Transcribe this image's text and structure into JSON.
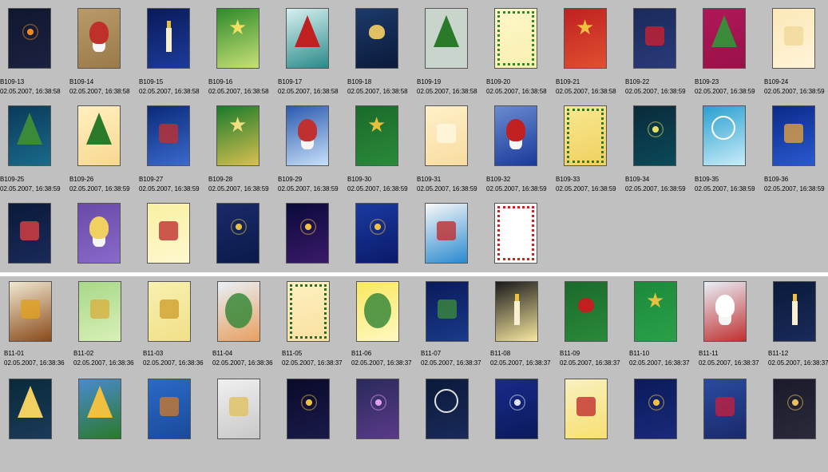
{
  "panels": [
    {
      "rows": [
        [
          {
            "id": "B109-13",
            "date": "02.05.2007, 16:38:58",
            "thumb": "fireplace",
            "colors": [
              "#0f1730",
              "#1b2240",
              "#f08a20"
            ]
          },
          {
            "id": "B109-14",
            "date": "02.05.2007, 16:38:58",
            "thumb": "elf-on-branch",
            "colors": [
              "#b89a6a",
              "#9a7a48",
              "#c0302a"
            ]
          },
          {
            "id": "B109-15",
            "date": "02.05.2007, 16:38:58",
            "thumb": "lantern",
            "colors": [
              "#0a1a5a",
              "#1c3c9a",
              "#e8c040"
            ]
          },
          {
            "id": "B109-16",
            "date": "02.05.2007, 16:38:58",
            "thumb": "green-oval-stars",
            "colors": [
              "#2e8a2a",
              "#c8e078",
              "#f0e060"
            ]
          },
          {
            "id": "B109-17",
            "date": "02.05.2007, 16:38:58",
            "thumb": "holly-teal",
            "colors": [
              "#d8f0f0",
              "#2a8a8a",
              "#c02020"
            ]
          },
          {
            "id": "B109-18",
            "date": "02.05.2007, 16:38:58",
            "thumb": "heart-ornament",
            "colors": [
              "#1c3a6a",
              "#0a1a3a",
              "#e0c060"
            ]
          },
          {
            "id": "B109-19",
            "date": "02.05.2007, 16:38:58",
            "thumb": "holly-corner",
            "colors": [
              "#c8d4cc",
              "#c8d4cc",
              "#2a7a2a"
            ]
          },
          {
            "id": "B109-20",
            "date": "02.05.2007, 16:38:58",
            "thumb": "holly-frame",
            "colors": [
              "#fff6c8",
              "#f8f0b0",
              "#2a8a2a"
            ]
          },
          {
            "id": "B109-21",
            "date": "02.05.2007, 16:38:58",
            "thumb": "star-red",
            "colors": [
              "#c02020",
              "#e05030",
              "#f0c040"
            ]
          },
          {
            "id": "B109-22",
            "date": "02.05.2007, 16:38:59",
            "thumb": "poinsettia",
            "colors": [
              "#1a2a5a",
              "#2a3a7a",
              "#c82030"
            ]
          },
          {
            "id": "B109-23",
            "date": "02.05.2007, 16:38:59",
            "thumb": "holly-magenta",
            "colors": [
              "#b01858",
              "#9a1048",
              "#3a8a3a"
            ]
          },
          {
            "id": "B109-24",
            "date": "02.05.2007, 16:38:59",
            "thumb": "cream-plain",
            "colors": [
              "#fbe8b8",
              "#fff4d8",
              "#f0d898"
            ]
          }
        ],
        [
          {
            "id": "B109-25",
            "date": "02.05.2007, 16:38:59",
            "thumb": "teal-garland",
            "colors": [
              "#0a3a5a",
              "#1a6a8a",
              "#3a8a3a"
            ]
          },
          {
            "id": "B109-26",
            "date": "02.05.2007, 16:38:59",
            "thumb": "pine-branch",
            "colors": [
              "#fff0c0",
              "#f8d890",
              "#2a7a2a"
            ]
          },
          {
            "id": "B109-27",
            "date": "02.05.2007, 16:38:59",
            "thumb": "gift-blue",
            "colors": [
              "#0a2a7a",
              "#3a6acc",
              "#c03030"
            ]
          },
          {
            "id": "B109-28",
            "date": "02.05.2007, 16:38:59",
            "thumb": "green-gold",
            "colors": [
              "#1a7a2a",
              "#d8c050",
              "#f0e080"
            ]
          },
          {
            "id": "B109-29",
            "date": "02.05.2007, 16:38:59",
            "thumb": "gnome-snow",
            "colors": [
              "#2a5ab0",
              "#c8e0f8",
              "#c03030"
            ]
          },
          {
            "id": "B109-30",
            "date": "02.05.2007, 16:38:59",
            "thumb": "gold-stars-green",
            "colors": [
              "#1a6a2a",
              "#2a8a3a",
              "#e8c040"
            ]
          },
          {
            "id": "B109-31",
            "date": "02.05.2007, 16:38:59",
            "thumb": "cream-rays",
            "colors": [
              "#fff0c8",
              "#f8dca0",
              "#fff8e0"
            ]
          },
          {
            "id": "B109-32",
            "date": "02.05.2007, 16:38:59",
            "thumb": "santa-blue",
            "colors": [
              "#6a8ad0",
              "#1a3a9a",
              "#c02020"
            ]
          },
          {
            "id": "B109-33",
            "date": "02.05.2007, 16:38:59",
            "thumb": "wreath-arch",
            "colors": [
              "#f8e890",
              "#f0d060",
              "#2a7a2a"
            ]
          },
          {
            "id": "B109-34",
            "date": "02.05.2007, 16:38:59",
            "thumb": "fireworks-teal",
            "colors": [
              "#0a2a3a",
              "#0a4a5a",
              "#e8e060"
            ]
          },
          {
            "id": "B109-35",
            "date": "02.05.2007, 16:38:59",
            "thumb": "clock-cyan",
            "colors": [
              "#2aa0d0",
              "#c8ecf8",
              "#ffffff"
            ]
          },
          {
            "id": "B109-36",
            "date": "02.05.2007, 16:38:59",
            "thumb": "building-night",
            "colors": [
              "#0a2a8a",
              "#2a5ad0",
              "#e0a040"
            ]
          }
        ],
        [
          {
            "id": "",
            "date": "",
            "thumb": "village-night",
            "colors": [
              "#0a1a3a",
              "#1a2a5a",
              "#e04040"
            ]
          },
          {
            "id": "",
            "date": "",
            "thumb": "wizard-purple",
            "colors": [
              "#6a4aa8",
              "#8a6ac8",
              "#f0d060"
            ]
          },
          {
            "id": "",
            "date": "",
            "thumb": "kite-yellow",
            "colors": [
              "#f8f0a0",
              "#fff8d0",
              "#c03030"
            ]
          },
          {
            "id": "",
            "date": "",
            "thumb": "rockets-blue",
            "colors": [
              "#1a2a6a",
              "#0a1a4a",
              "#e8c040"
            ]
          },
          {
            "id": "",
            "date": "",
            "thumb": "rockets-night",
            "colors": [
              "#0a0a3a",
              "#3a1a6a",
              "#f0c040"
            ]
          },
          {
            "id": "",
            "date": "",
            "thumb": "rocket-trail",
            "colors": [
              "#1a3aa0",
              "#0a1a6a",
              "#f0c040"
            ]
          },
          {
            "id": "",
            "date": "",
            "thumb": "cake-sky",
            "colors": [
              "#f8f8f8",
              "#2a8ad0",
              "#c03030"
            ]
          },
          {
            "id": "",
            "date": "",
            "thumb": "boom-frame",
            "colors": [
              "#ffffff",
              "#ffffff",
              "#d02020"
            ]
          }
        ]
      ]
    },
    {
      "rows": [
        [
          {
            "id": "B11-01",
            "date": "02.05.2007, 16:38:36",
            "thumb": "barrel-party",
            "colors": [
              "#f0e8d0",
              "#8a4a1a",
              "#e0a020"
            ]
          },
          {
            "id": "B11-02",
            "date": "02.05.2007, 16:38:36",
            "thumb": "easter-green",
            "colors": [
              "#a8d888",
              "#d8f0b8",
              "#d8b040"
            ]
          },
          {
            "id": "B11-03",
            "date": "02.05.2007, 16:38:36",
            "thumb": "pattern-yellow",
            "colors": [
              "#f8f0b0",
              "#f0e088",
              "#d0a030"
            ]
          },
          {
            "id": "B11-04",
            "date": "02.05.2007, 16:38:36",
            "thumb": "painted-egg",
            "colors": [
              "#e8f0f8",
              "#e8a060",
              "#3a8a3a"
            ]
          },
          {
            "id": "B11-05",
            "date": "02.05.2007, 16:38:37",
            "thumb": "pine-frame",
            "colors": [
              "#fff0c0",
              "#f8e0a0",
              "#2a6a2a"
            ]
          },
          {
            "id": "B11-06",
            "date": "02.05.2007, 16:38:37",
            "thumb": "sun-burst",
            "colors": [
              "#f8e860",
              "#fff8c0",
              "#3a8a3a"
            ]
          },
          {
            "id": "B11-07",
            "date": "02.05.2007, 16:38:37",
            "thumb": "ornament-night",
            "colors": [
              "#0a1a5a",
              "#1a3a8a",
              "#3a8a3a"
            ]
          },
          {
            "id": "B11-08",
            "date": "02.05.2007, 16:38:37",
            "thumb": "candle-dark",
            "colors": [
              "#1a1a1a",
              "#f8e8a0",
              "#f0c040"
            ]
          },
          {
            "id": "B11-09",
            "date": "02.05.2007, 16:38:37",
            "thumb": "hearts-green",
            "colors": [
              "#1a6a2a",
              "#2a8a3a",
              "#c02020"
            ]
          },
          {
            "id": "B11-10",
            "date": "02.05.2007, 16:38:37",
            "thumb": "stars-green",
            "colors": [
              "#1a8a3a",
              "#2aa04a",
              "#e8c040"
            ]
          },
          {
            "id": "B11-11",
            "date": "02.05.2007, 16:38:37",
            "thumb": "santa-face",
            "colors": [
              "#e8f0f8",
              "#c03030",
              "#ffffff"
            ]
          },
          {
            "id": "B11-12",
            "date": "02.05.2007, 16:38:37",
            "thumb": "candle-night",
            "colors": [
              "#0a1a3a",
              "#1a2a5a",
              "#f0c040"
            ]
          }
        ],
        [
          {
            "id": "",
            "date": "",
            "thumb": "garland-night",
            "colors": [
              "#0a2a3a",
              "#1a3a5a",
              "#f0d060"
            ]
          },
          {
            "id": "",
            "date": "",
            "thumb": "xmas-tree",
            "colors": [
              "#4a8ad0",
              "#2a7a2a",
              "#f0c040"
            ]
          },
          {
            "id": "",
            "date": "",
            "thumb": "roast-turkey",
            "colors": [
              "#2a6ac8",
              "#1a4a9a",
              "#c87830"
            ]
          },
          {
            "id": "",
            "date": "",
            "thumb": "church-window",
            "colors": [
              "#f0f0f0",
              "#c8c8c8",
              "#e0c060"
            ]
          },
          {
            "id": "",
            "date": "",
            "thumb": "fireworks-night",
            "colors": [
              "#0a0a2a",
              "#1a1a4a",
              "#f0c040"
            ]
          },
          {
            "id": "",
            "date": "",
            "thumb": "fireworks-purple",
            "colors": [
              "#2a2a5a",
              "#5a3a8a",
              "#e0a0f0"
            ]
          },
          {
            "id": "",
            "date": "",
            "thumb": "clock-night",
            "colors": [
              "#0a1a3a",
              "#1a2a5a",
              "#e0e0e0"
            ]
          },
          {
            "id": "",
            "date": "",
            "thumb": "starfield",
            "colors": [
              "#1a2a8a",
              "#0a1a5a",
              "#e0e8ff"
            ]
          },
          {
            "id": "",
            "date": "",
            "thumb": "champagne",
            "colors": [
              "#f8f0c0",
              "#f8e070",
              "#c03030"
            ]
          },
          {
            "id": "",
            "date": "",
            "thumb": "fireworks-blue",
            "colors": [
              "#0a1a5a",
              "#1a2a7a",
              "#f0c040"
            ]
          },
          {
            "id": "",
            "date": "",
            "thumb": "cracker-red",
            "colors": [
              "#2a4aa0",
              "#1a2a6a",
              "#c02040"
            ]
          },
          {
            "id": "",
            "date": "",
            "thumb": "sparkler-gold",
            "colors": [
              "#1a1a2a",
              "#2a2a3a",
              "#e8c060"
            ]
          }
        ]
      ]
    }
  ]
}
